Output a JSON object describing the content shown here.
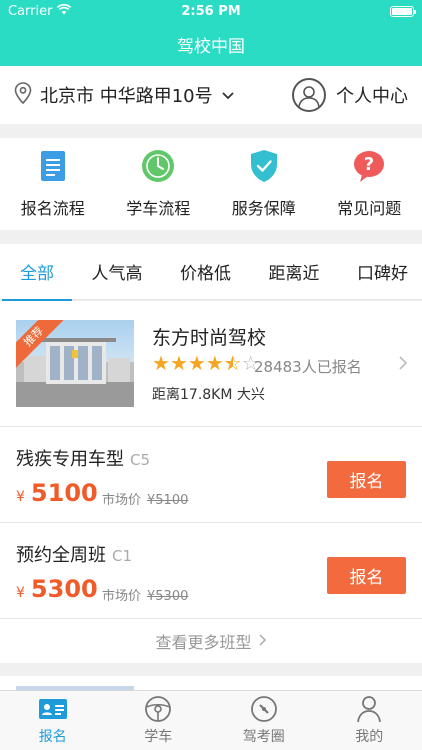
{
  "status": {
    "carrier": "Carrier",
    "time": "2:56 PM"
  },
  "nav": {
    "title": "驾校中国"
  },
  "location": {
    "text": "北京市 中华路甲10号"
  },
  "profile": {
    "label": "个人中心"
  },
  "quick": [
    {
      "label": "报名流程",
      "icon": "document-icon"
    },
    {
      "label": "学车流程",
      "icon": "clock-icon"
    },
    {
      "label": "服务保障",
      "icon": "shield-check-icon"
    },
    {
      "label": "常见问题",
      "icon": "question-bubble-icon"
    }
  ],
  "filters": [
    "全部",
    "人气高",
    "价格低",
    "距离近",
    "口碑好"
  ],
  "school": {
    "badge": "推荐",
    "name": "东方时尚驾校",
    "rating": 4.5,
    "enrolled": "28483人已报名",
    "distance": "距离17.8KM 大兴"
  },
  "courses": [
    {
      "title": "残疾专用车型",
      "code": "C5",
      "yen": "¥",
      "price": "5100",
      "market_label": "市场价",
      "market_price": "¥5100",
      "button": "报名"
    },
    {
      "title": "预约全周班",
      "code": "C1",
      "yen": "¥",
      "price": "5300",
      "market_label": "市场价",
      "market_price": "¥5300",
      "button": "报名"
    }
  ],
  "more": {
    "label": "查看更多班型"
  },
  "tabbar": [
    {
      "label": "报名",
      "icon": "id-card-icon",
      "active": true
    },
    {
      "label": "学车",
      "icon": "steering-wheel-icon",
      "active": false
    },
    {
      "label": "驾考圈",
      "icon": "compass-icon",
      "active": false
    },
    {
      "label": "我的",
      "icon": "person-icon",
      "active": false
    }
  ],
  "colors": {
    "brand": "#2bdcc4",
    "accent": "#1e9bd8",
    "price": "#f15b29",
    "button": "#f26a3e",
    "star": "#f6a623"
  }
}
